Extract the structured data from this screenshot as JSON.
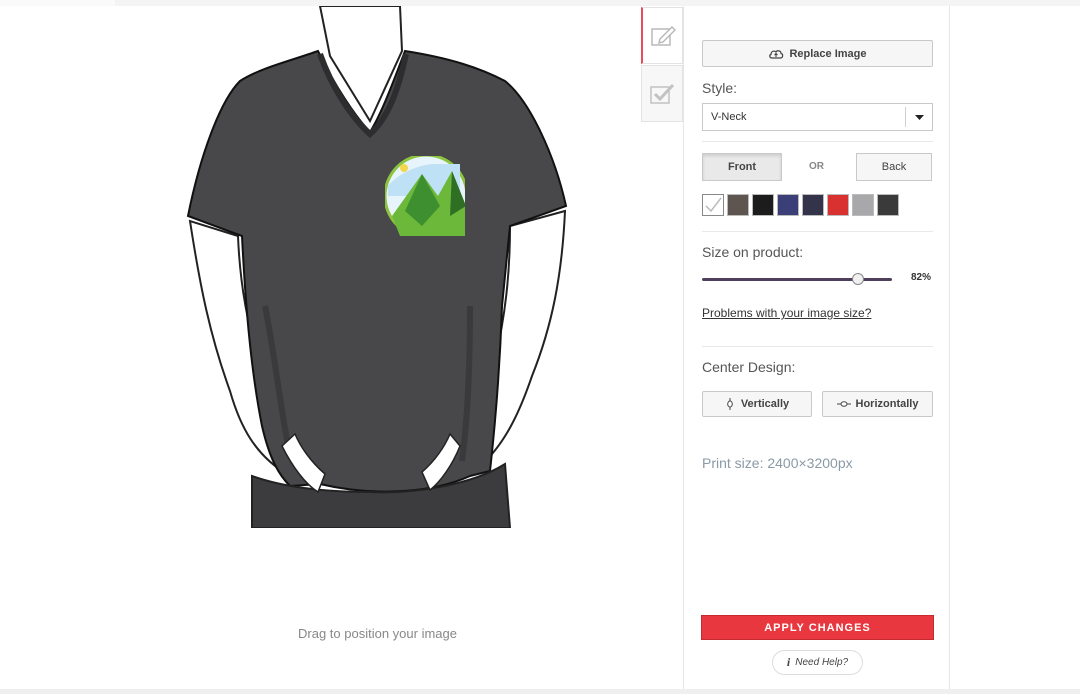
{
  "preview": {
    "drag_hint": "Drag to position your image"
  },
  "tabs": [
    {
      "icon": "pencil-icon",
      "active": true
    },
    {
      "icon": "checkmark-icon",
      "active": false
    }
  ],
  "panel": {
    "replace_image_label": "Replace Image",
    "style_label": "Style:",
    "style_value": "V-Neck",
    "side": {
      "front_label": "Front",
      "or_label": "OR",
      "back_label": "Back",
      "selected": "Front"
    },
    "colors": [
      {
        "name": "white",
        "hex": "#ffffff",
        "selected": true
      },
      {
        "name": "brown-heather",
        "hex": "#5e5550"
      },
      {
        "name": "black",
        "hex": "#1c1c1c"
      },
      {
        "name": "navy",
        "hex": "#3b3f78"
      },
      {
        "name": "dark-navy",
        "hex": "#33334a"
      },
      {
        "name": "red",
        "hex": "#d93030"
      },
      {
        "name": "heather-grey",
        "hex": "#a8a8ab"
      },
      {
        "name": "charcoal-heather",
        "hex": "#3a3a3a"
      }
    ],
    "size_label": "Size on product:",
    "size_value": 82,
    "size_text": "82%",
    "image_size_link": "Problems with your image size?",
    "center_label": "Center Design:",
    "vertically_label": "Vertically",
    "horizontally_label": "Horizontally",
    "print_size": "Print size: 2400×3200px",
    "apply_label": "APPLY CHANGES",
    "help_label": "Need Help?"
  }
}
